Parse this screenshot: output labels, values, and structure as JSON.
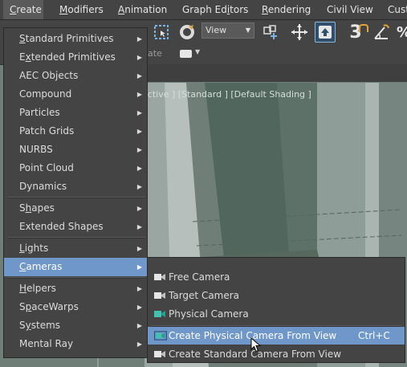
{
  "menubar": {
    "items": [
      {
        "label": "Create",
        "u": "C",
        "rest": "reate"
      },
      {
        "label": "Modifiers",
        "u": "M",
        "rest": "odifiers"
      },
      {
        "label": "Animation",
        "u": "A",
        "rest": "nimation"
      },
      {
        "label": "Graph Editors",
        "pre": "Graph Ed",
        "u": "i",
        "rest": "tors"
      },
      {
        "label": "Rendering",
        "u": "R",
        "rest": "endering"
      },
      {
        "label": "Civil View",
        "pre": "",
        "u": "",
        "rest": "Civil View"
      },
      {
        "label": "Cust",
        "pre": "",
        "u": "",
        "rest": "Cust"
      }
    ]
  },
  "toolbar": {
    "view_select": "View",
    "snap_label": "3",
    "row2_text": "ate"
  },
  "viewport": {
    "label": "ective ] [Standard ] [Default Shading ]"
  },
  "create_menu": {
    "items": [
      {
        "label": "Standard Primitives",
        "u": "S",
        "rest": "tandard Primitives",
        "arrow": true
      },
      {
        "label": "Extended Primitives",
        "pre": "E",
        "u": "x",
        "rest": "tended Primitives",
        "arrow": true
      },
      {
        "label": "AEC Objects",
        "pre": "",
        "u": "",
        "rest": "AEC Objects",
        "arrow": true
      },
      {
        "label": "Compound",
        "pre": "",
        "u": "",
        "rest": "Compound",
        "arrow": true
      },
      {
        "label": "Particles",
        "pre": "",
        "u": "",
        "rest": "Particles",
        "arrow": true
      },
      {
        "label": "Patch Grids",
        "pre": "",
        "u": "",
        "rest": "Patch Grids",
        "arrow": true
      },
      {
        "label": "NURBS",
        "pre": "",
        "u": "",
        "rest": "NURBS",
        "arrow": true
      },
      {
        "label": "Point Cloud",
        "pre": "",
        "u": "",
        "rest": "Point Cloud",
        "arrow": true
      },
      {
        "label": "Dynamics",
        "pre": "",
        "u": "",
        "rest": "Dynamics",
        "arrow": true
      },
      {
        "label": "Shapes",
        "pre": "S",
        "u": "h",
        "rest": "apes",
        "arrow": true
      },
      {
        "label": "Extended Shapes",
        "pre": "",
        "u": "",
        "rest": "Extended Shapes",
        "arrow": true
      },
      {
        "label": "Lights",
        "pre": "",
        "u": "L",
        "rest": "ights",
        "arrow": true
      },
      {
        "label": "Cameras",
        "pre": "",
        "u": "C",
        "rest": "ameras",
        "arrow": true
      },
      {
        "label": "Helpers",
        "pre": "",
        "u": "H",
        "rest": "elpers",
        "arrow": true
      },
      {
        "label": "SpaceWarps",
        "pre": "S",
        "u": "p",
        "rest": "aceWarps",
        "arrow": true
      },
      {
        "label": "Systems",
        "pre": "S",
        "u": "y",
        "rest": "stems",
        "arrow": true
      },
      {
        "label": "Mental Ray",
        "pre": "",
        "u": "",
        "rest": "Mental Ray",
        "arrow": true
      }
    ]
  },
  "camera_menu": {
    "items": [
      {
        "label": "Free Camera",
        "icon": "free-camera-icon",
        "shortcut": ""
      },
      {
        "label": "Target Camera",
        "icon": "target-camera-icon",
        "shortcut": ""
      },
      {
        "label": "Physical Camera",
        "icon": "physical-camera-icon",
        "shortcut": ""
      },
      {
        "label": "Create Physical Camera From View",
        "icon": "physical-camera-from-view-icon",
        "shortcut": "Ctrl+C"
      },
      {
        "label": "Create Standard Camera From View",
        "icon": "standard-camera-from-view-icon",
        "shortcut": ""
      }
    ]
  },
  "colors": {
    "highlight": "#6f97c9",
    "menu_bg": "#444444",
    "viewport": "#6f7f78"
  }
}
